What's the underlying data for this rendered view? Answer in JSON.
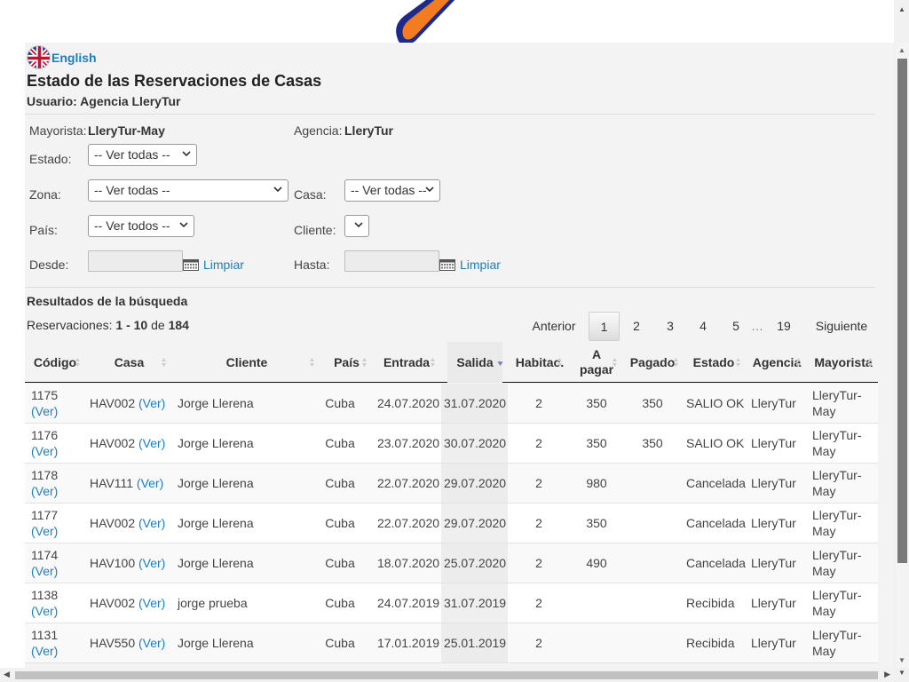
{
  "language": {
    "label": "English"
  },
  "page": {
    "title": "Estado de las Reservaciones de Casas",
    "user": "Usuario: Agencia LleryTur"
  },
  "filters": {
    "mayorista_label": "Mayorista:",
    "mayorista_value": "LleryTur-May",
    "agencia_label": "Agencia:",
    "agencia_value": "LleryTur",
    "estado_label": "Estado:",
    "estado_value": "-- Ver todas --",
    "zona_label": "Zona:",
    "zona_value": "-- Ver todas --",
    "casa_label": "Casa:",
    "casa_value": "-- Ver todas --",
    "pais_label": "País:",
    "pais_value": "-- Ver todos --",
    "cliente_label": "Cliente:",
    "cliente_value": "",
    "desde_label": "Desde:",
    "desde_value": "",
    "hasta_label": "Hasta:",
    "hasta_value": "",
    "limpiar": "Limpiar"
  },
  "results": {
    "title": "Resultados de la búsqueda",
    "count_prefix": "Reservaciones:",
    "count_range": "1 - 10",
    "count_de": "de",
    "count_total": "184"
  },
  "pagination": {
    "prev": "Anterior",
    "pages": [
      "1",
      "2",
      "3",
      "4",
      "5"
    ],
    "ellipsis": "…",
    "last": "19",
    "next": "Siguiente",
    "current": "1"
  },
  "table": {
    "headers": [
      "Código",
      "Casa",
      "Cliente",
      "País",
      "Entrada",
      "Salida",
      "Habitac.",
      "A pagar",
      "Pagado",
      "Estado",
      "Agencia",
      "Mayorista"
    ],
    "ver_label": "(Ver)",
    "rows": [
      {
        "codigo": "1175",
        "casa": "HAV002",
        "cliente": "Jorge Llerena",
        "pais": "Cuba",
        "entrada": "24.07.2020",
        "salida": "31.07.2020",
        "habitac": "2",
        "apagar": "350",
        "pagado": "350",
        "estado": "SALIO OK",
        "agencia": "LleryTur",
        "mayorista": "LleryTur-May"
      },
      {
        "codigo": "1176",
        "casa": "HAV002",
        "cliente": "Jorge Llerena",
        "pais": "Cuba",
        "entrada": "23.07.2020",
        "salida": "30.07.2020",
        "habitac": "2",
        "apagar": "350",
        "pagado": "350",
        "estado": "SALIO OK",
        "agencia": "LleryTur",
        "mayorista": "LleryTur-May"
      },
      {
        "codigo": "1178",
        "casa": "HAV111",
        "cliente": "Jorge Llerena",
        "pais": "Cuba",
        "entrada": "22.07.2020",
        "salida": "29.07.2020",
        "habitac": "2",
        "apagar": "980",
        "pagado": "",
        "estado": "Cancelada",
        "agencia": "LleryTur",
        "mayorista": "LleryTur-May"
      },
      {
        "codigo": "1177",
        "casa": "HAV002",
        "cliente": "Jorge Llerena",
        "pais": "Cuba",
        "entrada": "22.07.2020",
        "salida": "29.07.2020",
        "habitac": "2",
        "apagar": "350",
        "pagado": "",
        "estado": "Cancelada",
        "agencia": "LleryTur",
        "mayorista": "LleryTur-May"
      },
      {
        "codigo": "1174",
        "casa": "HAV100",
        "cliente": "Jorge Llerena",
        "pais": "Cuba",
        "entrada": "18.07.2020",
        "salida": "25.07.2020",
        "habitac": "2",
        "apagar": "490",
        "pagado": "",
        "estado": "Cancelada",
        "agencia": "LleryTur",
        "mayorista": "LleryTur-May"
      },
      {
        "codigo": "1138",
        "casa": "HAV002",
        "cliente": "jorge prueba",
        "pais": "Cuba",
        "entrada": "24.07.2019",
        "salida": "31.07.2019",
        "habitac": "2",
        "apagar": "",
        "pagado": "",
        "estado": "Recibida",
        "agencia": "LleryTur",
        "mayorista": "LleryTur-May"
      },
      {
        "codigo": "1131",
        "casa": "HAV550",
        "cliente": "Jorge Llerena",
        "pais": "Cuba",
        "entrada": "17.01.2019",
        "salida": "25.01.2019",
        "habitac": "2",
        "apagar": "",
        "pagado": "",
        "estado": "Recibida",
        "agencia": "LleryTur",
        "mayorista": "LleryTur-May"
      }
    ]
  },
  "colors": {
    "link": "#1a7fc1",
    "logo_orange": "#f47c20",
    "logo_navy": "#1d2a8a"
  },
  "icons": {
    "flag": "uk-flag-icon",
    "calendar": "calendar-icon",
    "sort": "sort-arrows-icon",
    "sort_desc": "sort-desc-icon"
  }
}
